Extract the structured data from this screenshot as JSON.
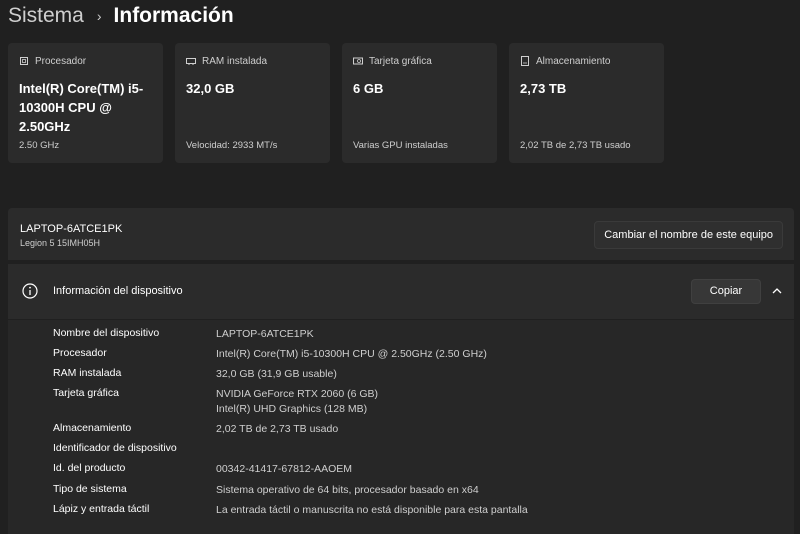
{
  "breadcrumb": {
    "parent": "Sistema",
    "separator": "›",
    "current": "Información"
  },
  "cards": [
    {
      "icon": "processor-icon",
      "label": "Procesador",
      "value": "Intel(R) Core(TM) i5-10300H CPU @ 2.50GHz",
      "footer": "2.50 GHz"
    },
    {
      "icon": "ram-icon",
      "label": "RAM instalada",
      "value": "32,0 GB",
      "footer": "Velocidad: 2933 MT/s"
    },
    {
      "icon": "graphics-card-icon",
      "label": "Tarjeta gráfica",
      "value": "6 GB",
      "footer": "Varias GPU instaladas"
    },
    {
      "icon": "storage-icon",
      "label": "Almacenamiento",
      "value": "2,73 TB",
      "footer": "2,02 TB de 2,73 TB usado"
    }
  ],
  "device": {
    "name": "LAPTOP-6ATCE1PK",
    "model": "Legion 5 15IMH05H",
    "rename_label": "Cambiar el nombre de este equipo"
  },
  "info": {
    "title": "Información del dispositivo",
    "copy_label": "Copiar",
    "rows": [
      {
        "label": "Nombre del dispositivo",
        "value": "LAPTOP-6ATCE1PK",
        "value2": ""
      },
      {
        "label": "Procesador",
        "value": "Intel(R) Core(TM) i5-10300H CPU @ 2.50GHz (2.50 GHz)",
        "value2": ""
      },
      {
        "label": "RAM instalada",
        "value": "32,0 GB (31,9 GB usable)",
        "value2": ""
      },
      {
        "label": "Tarjeta gráfica",
        "value": "NVIDIA GeForce RTX 2060 (6 GB)",
        "value2": "Intel(R) UHD Graphics (128 MB)"
      },
      {
        "label": "Almacenamiento",
        "value": "2,02 TB de 2,73 TB usado",
        "value2": ""
      },
      {
        "label": "Identificador de dispositivo",
        "value": "",
        "value2": ""
      },
      {
        "label": "Id. del producto",
        "value": "00342-41417-67812-AAOEM",
        "value2": ""
      },
      {
        "label": "Tipo de sistema",
        "value": "Sistema operativo de 64 bits, procesador basado en x64",
        "value2": ""
      },
      {
        "label": "Lápiz y entrada táctil",
        "value": "La entrada táctil o manuscrita no está disponible para esta pantalla",
        "value2": ""
      }
    ]
  }
}
